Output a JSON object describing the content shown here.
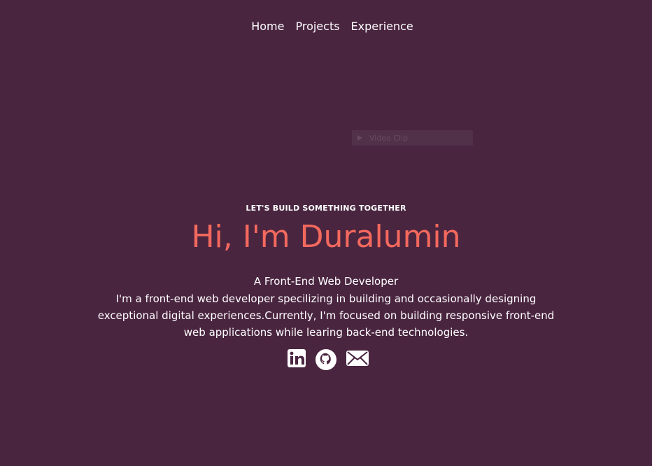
{
  "nav": {
    "items": [
      {
        "label": "Home"
      },
      {
        "label": "Projects"
      },
      {
        "label": "Experience"
      }
    ]
  },
  "video": {
    "label": "Video Clip"
  },
  "hero": {
    "tagline": "LET'S BUILD SOMETHING TOGETHER",
    "greeting": "Hi, I'm Duralumin",
    "role": "A Front-End Web Developer",
    "description": "I'm a front-end web developer specilizing in building and occasionally designing exceptional digital experiences.Currently, I'm focused on building responsive front-end web applications while learing back-end technologies."
  },
  "socials": [
    {
      "icon": "linkedin-icon"
    },
    {
      "icon": "github-icon"
    },
    {
      "icon": "mail-icon"
    }
  ],
  "colors": {
    "background": "#4a2540",
    "accent": "#f4695d",
    "text": "#ffffff"
  }
}
